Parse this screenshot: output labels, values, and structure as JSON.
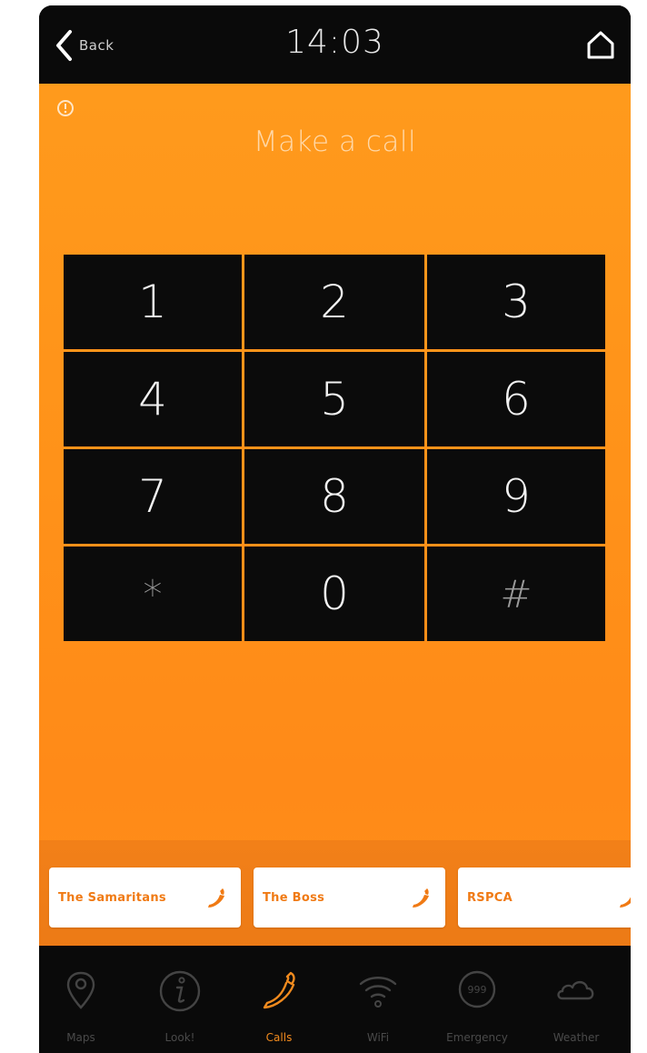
{
  "topbar": {
    "back_label": "Back",
    "time": "14:03",
    "icons": {
      "back": "chevron-left-icon",
      "home": "home-icon"
    }
  },
  "page": {
    "title": "Make a call",
    "info_icon": "info-icon"
  },
  "keypad": {
    "keys": [
      "1",
      "2",
      "3",
      "4",
      "5",
      "6",
      "7",
      "8",
      "9",
      "*",
      "0",
      "#"
    ]
  },
  "contacts": [
    {
      "name": "The Samaritans",
      "icon": "phone-icon"
    },
    {
      "name": "The Boss",
      "icon": "phone-icon"
    },
    {
      "name": "RSPCA",
      "icon": "phone-icon"
    }
  ],
  "nav": {
    "items": [
      {
        "label": "Maps",
        "icon": "map-pin-icon",
        "active": false
      },
      {
        "label": "Look!",
        "icon": "info-circle-icon",
        "active": false
      },
      {
        "label": "Calls",
        "icon": "phone-icon",
        "active": true
      },
      {
        "label": "WiFi",
        "icon": "wifi-icon",
        "active": false
      },
      {
        "label": "Emergency",
        "icon": "emergency-999-icon",
        "active": false
      },
      {
        "label": "Weather",
        "icon": "cloud-icon",
        "active": false
      }
    ]
  },
  "colors": {
    "accent": "#ff9a1c",
    "dark": "#0a0a0a",
    "contact_text": "#f07a14",
    "nav_inactive": "#4a4a4a",
    "nav_active": "#f08a1e"
  }
}
